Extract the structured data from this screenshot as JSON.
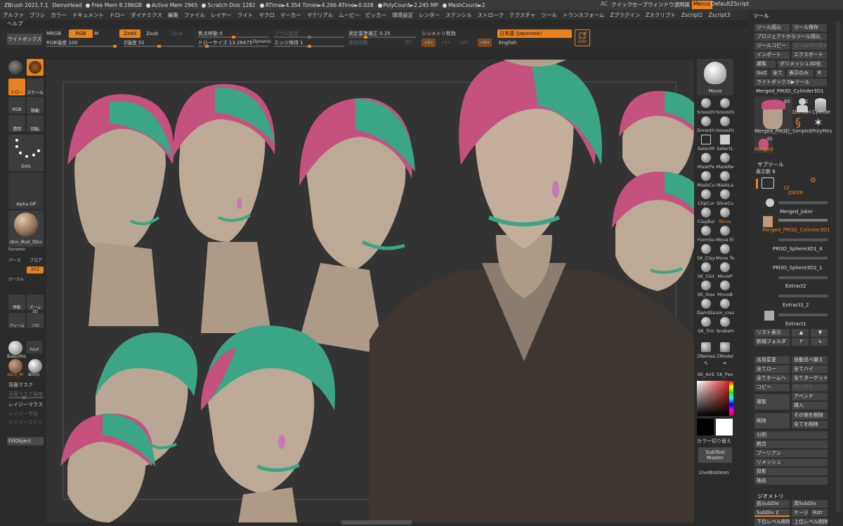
{
  "titlebar": {
    "app": "ZBrush 2021.7.1",
    "project": "DemoHead",
    "free_mem": "Free Mem 8.196GB",
    "active_mem": "Active Mem 2965",
    "scratch": "Scratch Disk 1282",
    "rtime": "RTime►4.354 Timer►4.266 ATime►0.028",
    "poly": "PolyCount►2.245 MP",
    "mesh": "MeshCount►2",
    "ac": "AC",
    "quicksave": "クイックセーブ",
    "transp": "ウィンドウ透明度",
    "menus": "Menus",
    "script": "DefaultZScript"
  },
  "menu": [
    "アルファ",
    "ブラシ",
    "カラー",
    "ドキュメント",
    "ドロー",
    "ダイナミクス",
    "編集",
    "ファイル",
    "レイヤー",
    "ライト",
    "マクロ",
    "マーカー",
    "マテリアル",
    "ムービー",
    "ピッカー",
    "環境設定",
    "レンダー",
    "ステンシル",
    "ストローク",
    "テクスチャ",
    "ツール",
    "トランスフォーム",
    "Zプラグイン",
    "Zスクリプト",
    "Zscript2",
    "Zscript3"
  ],
  "help": "ヘルプ",
  "shelf": {
    "lightbox": "ライトボックス",
    "mrgb": "MRGB",
    "rgb": "RGB",
    "m": "M",
    "zadd": "Zadd",
    "zsub": "Zsub",
    "zcut": "Zcut",
    "rgb_int_label": "RGB強度",
    "rgb_int": "100",
    "z_int_label": "Z強度",
    "z_int": "51",
    "focal_label": "焦点移動",
    "focal": "0",
    "draw_size_label": "ドローサイズ",
    "draw_size": "13.26475",
    "dynamic": "Dynamic",
    "brush_set": "ブラシ設定",
    "edge_label": "エッジ保持",
    "edge": "1",
    "radial": "放射回数",
    "r": "(R)",
    "measure_label": "測定基準補正",
    "measure": "0.25",
    "sym_label": "シンメトリ有効",
    "x": "•X•",
    "y": "•Y•",
    "z": "•Z•",
    "mx": "•M•",
    "lang": "日本語 (Japanese)",
    "english": "English",
    "edit": "Edit"
  },
  "left": {
    "draw": "ドロー",
    "scale": "スケール",
    "rgb": "RGB",
    "move": "移動",
    "transp": "透明",
    "rotate": "回転",
    "dots": "Dots",
    "alpha": "Alpha Off",
    "brush": "zbro_Mud_3Dcc",
    "dynamic": "Dynamic",
    "perspective": "パース",
    "floor": "フロア",
    "local": "ローカル",
    "xyz": "XYZ",
    "move2": "移動",
    "zoom": "ズーム3D",
    "frame": "フレーム",
    "solo": "ソロ",
    "basic": "BasicMa",
    "zbro_m": "zbro_M",
    "blinn": "Blinn",
    "polyf": "PolyF",
    "back_mask": "背面マスク",
    "back_mask_int": "背面マスク強度",
    "lazy": "レイジーマウス",
    "lazy_step": "レイジー半径",
    "lazy_stp": "レイジーステッ",
    "fill": "FillObject"
  },
  "right": {
    "move": "Move",
    "brushes": [
      "SmoothP",
      "SmoothP",
      "SmoothS",
      "SmoothE",
      "SelectR",
      "SelectL",
      "MaskPe",
      "MaskRe",
      "MaskCu",
      "MaskLa",
      "ClipCur",
      "SliceCu",
      "ClayBui",
      "Move",
      "FormSo",
      "Move El",
      "SK_Clay",
      "Move To",
      "SK_Clot",
      "MoveP",
      "SK_Slas",
      "MoveB",
      "DamSta",
      "sm_crea",
      "SK_Trin",
      "SnakeH",
      "ZRemes",
      "ZModel",
      "SK_AirE",
      "SK_Pen"
    ],
    "color_switch": "カラー切り替え",
    "subtool_master": "SubTool Master",
    "live_boolean": "LiveBoolean"
  },
  "panel": {
    "tool": "ツール",
    "load": "ツール読込",
    "save": "ツール保存",
    "proj_load": "プロジェクトからツール読込",
    "copy": "ツールコピー",
    "paste": "ツールペースト",
    "import": "インポート",
    "export": "エクスポート",
    "clone": "複製",
    "polymesh": "ポリメッシュ3D化",
    "goz": "GoZ",
    "all": "全て",
    "visible": "表示のみ",
    "r": "R",
    "lightbox_tool": "ライトボックス▶ツール",
    "current": "Merged_PM3D_Cylinder3D1",
    "count1": "65",
    "count2": "2",
    "thumbs": [
      "Merged_PM3D_",
      "DemoH",
      "Cylinde",
      "SimpleE",
      "PolyMes",
      "Merged"
    ],
    "count3": "65",
    "subtool": "サブツール",
    "display_count": "表示数 8",
    "layers": [
      {
        "n": "JOKER",
        "num": "12"
      },
      {
        "n": "Merged_joker"
      },
      {
        "n": "Merged_PM3D_Cylinder3D1"
      },
      {
        "n": "PM3D_Sphere3D1_4"
      },
      {
        "n": "PM3D_Sphere3D2_1"
      },
      {
        "n": "Extract2"
      },
      {
        "n": "Extract3_2"
      },
      {
        "n": "Extract1"
      }
    ],
    "list": "リスト表示",
    "new_folder": "新規フォルダ",
    "rename": "名前変更",
    "auto_sort": "自動並べ替え",
    "all_low": "全てロー",
    "all_high": "全てハイ",
    "all_home": "全てホームへ",
    "all_target": "全てターゲット",
    "copy2": "コピー",
    "paste2": "ペースト",
    "dup": "複製",
    "append": "アペンド",
    "insert": "挿入",
    "delete": "削除",
    "del_other": "その他を削除",
    "del_all": "全てを削除",
    "split": "分割",
    "merge": "統合",
    "boolean": "ブーリアン",
    "remesh": "リメッシュ",
    "project": "投影",
    "extract": "抽出",
    "geometry": "ジオメトリ",
    "low_subdiv": "低SubDiv",
    "high_subdiv": "高SubDiv",
    "subdiv": "SubDiv 2",
    "cage": "ケージ",
    "rstr": "Rstr",
    "del_lower": "下位レベル削除",
    "del_higher": "上位レベル削除"
  },
  "colors": {
    "accent": "#e8821f",
    "bg": "#2b2b2b",
    "panel": "#2e2e2e"
  }
}
